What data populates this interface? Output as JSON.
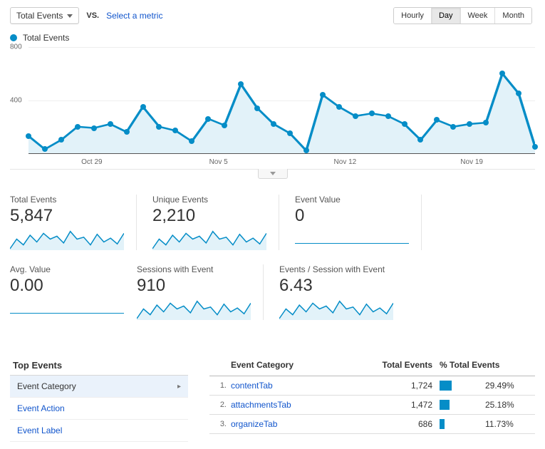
{
  "topbar": {
    "metric_dropdown_label": "Total Events",
    "vs_label": "VS.",
    "select_metric_label": "Select a metric",
    "granularity": [
      "Hourly",
      "Day",
      "Week",
      "Month"
    ],
    "granularity_active": "Day"
  },
  "legend": {
    "label": "Total Events"
  },
  "chart_data": {
    "type": "line",
    "title": "",
    "xlabel": "",
    "ylabel": "",
    "ylim": [
      0,
      800
    ],
    "y_ticks": [
      400,
      800
    ],
    "x_tick_labels": [
      "Oct 29",
      "Nov 5",
      "Nov 12",
      "Nov 19"
    ],
    "x": [
      0,
      1,
      2,
      3,
      4,
      5,
      6,
      7,
      8,
      9,
      10,
      11,
      12,
      13,
      14,
      15,
      16,
      17,
      18,
      19,
      20,
      21,
      22,
      23,
      24,
      25,
      26,
      27,
      28,
      29,
      30
    ],
    "values": [
      130,
      30,
      100,
      200,
      190,
      220,
      160,
      350,
      200,
      170,
      90,
      260,
      210,
      520,
      340,
      220,
      150,
      20,
      440,
      350,
      280,
      300,
      280,
      220,
      100,
      250,
      200,
      220,
      230,
      600,
      450,
      50
    ]
  },
  "scorecards": [
    {
      "label": "Total Events",
      "value": "5,847",
      "spark": "area"
    },
    {
      "label": "Unique Events",
      "value": "2,210",
      "spark": "area"
    },
    {
      "label": "Event Value",
      "value": "0",
      "spark": "flat"
    },
    {
      "label": "Avg. Value",
      "value": "0.00",
      "spark": "flat"
    },
    {
      "label": "Sessions with Event",
      "value": "910",
      "spark": "area"
    },
    {
      "label": "Events / Session with Event",
      "value": "6.43",
      "spark": "area"
    }
  ],
  "sidebar": {
    "title": "Top Events",
    "items": [
      {
        "label": "Event Category",
        "active": true
      },
      {
        "label": "Event Action",
        "active": false
      },
      {
        "label": "Event Label",
        "active": false
      }
    ]
  },
  "table": {
    "headers": {
      "category": "Event Category",
      "total": "Total Events",
      "pct": "% Total Events"
    },
    "rows": [
      {
        "idx": "1.",
        "category": "contentTab",
        "total": "1,724",
        "pct": 29.49,
        "pct_label": "29.49%"
      },
      {
        "idx": "2.",
        "category": "attachmentsTab",
        "total": "1,472",
        "pct": 25.18,
        "pct_label": "25.18%"
      },
      {
        "idx": "3.",
        "category": "organizeTab",
        "total": "686",
        "pct": 11.73,
        "pct_label": "11.73%"
      }
    ]
  },
  "colors": {
    "accent": "#058dc7",
    "fill": "#e2f2f9"
  }
}
